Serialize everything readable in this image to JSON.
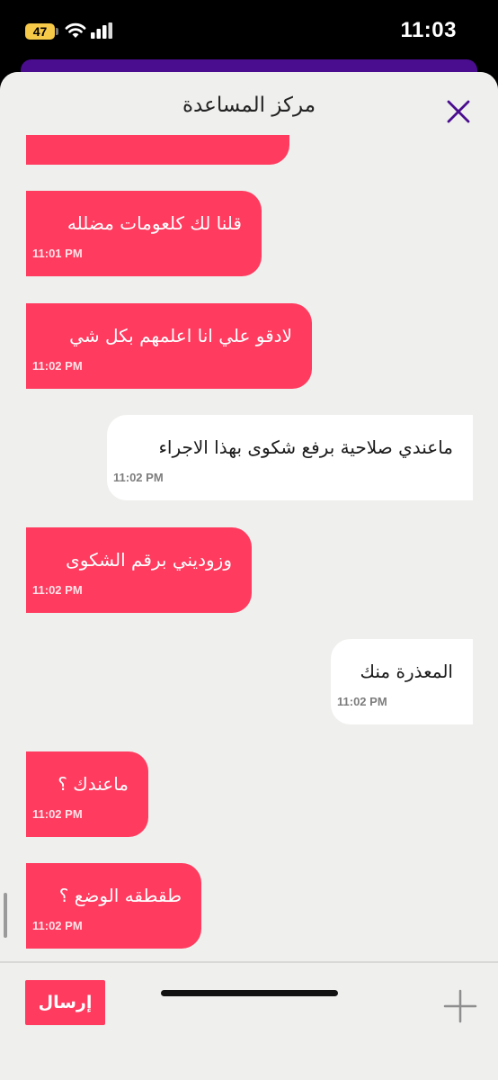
{
  "status_bar": {
    "battery_level": "47",
    "time": "11:03"
  },
  "header": {
    "title": "مركز المساعدة",
    "close_icon": "close-icon"
  },
  "messages": [
    {
      "sender": "agent",
      "text": "قلنا لك كلعومات مضلله",
      "time": "11:01 PM"
    },
    {
      "sender": "agent",
      "text": "لادقو علي انا اعلمهم بكل شي",
      "time": "11:02 PM"
    },
    {
      "sender": "user",
      "text": "ماعندي صلاحية برفع شكوى بهذا الاجراء",
      "time": "11:02 PM"
    },
    {
      "sender": "agent",
      "text": "وزوديني برقم الشكوى",
      "time": "11:02 PM"
    },
    {
      "sender": "user",
      "text": "المعذرة منك",
      "time": "11:02 PM"
    },
    {
      "sender": "agent",
      "text": "ماعندك ؟",
      "time": "11:02 PM"
    },
    {
      "sender": "agent",
      "text": "طقطقه الوضع ؟",
      "time": "11:02 PM"
    }
  ],
  "composer": {
    "send_label": "إرسال",
    "attach_icon": "plus-icon"
  },
  "colors": {
    "agent_bubble": "#ff3b5f",
    "user_bubble": "#ffffff",
    "sheet_background": "#efefed",
    "accent_purple": "#4a0d8f"
  }
}
